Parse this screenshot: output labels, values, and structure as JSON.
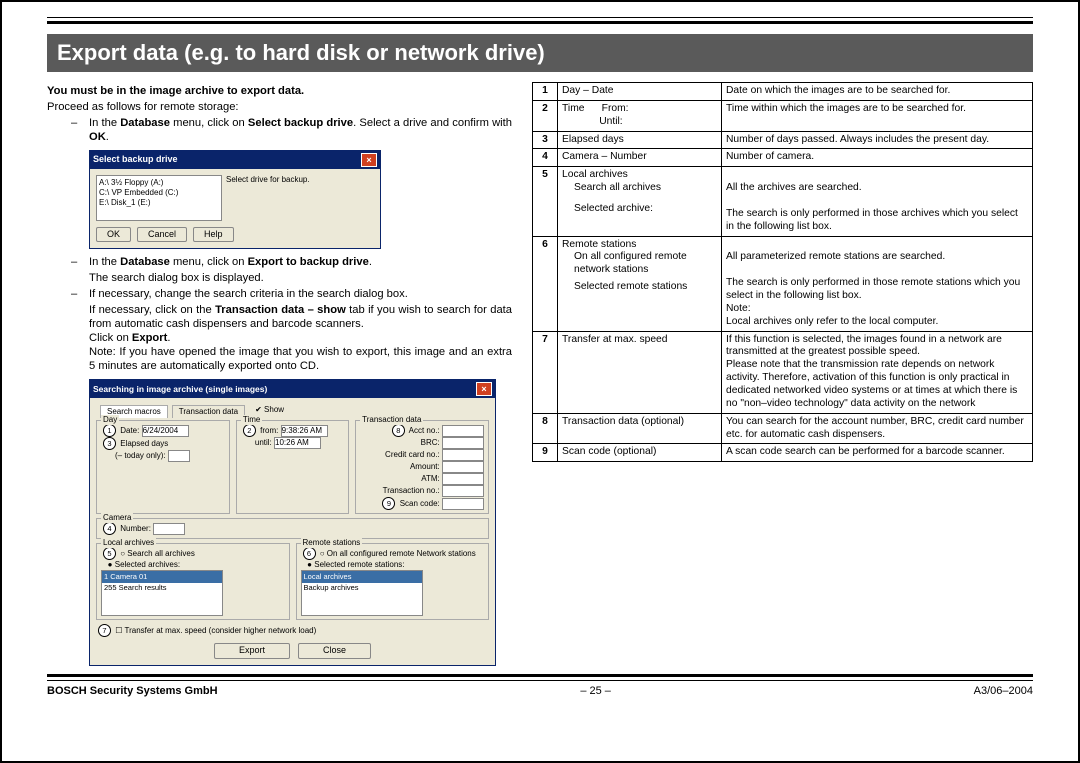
{
  "title": "Export data (e.g. to hard disk or network drive)",
  "intro_bold": "You must be in the image archive to export data.",
  "proceed": "Proceed as follows for remote storage:",
  "step1_pre": "In the ",
  "step1_b1": "Database",
  "step1_mid": " menu, click on ",
  "step1_b2": "Select backup drive",
  "step1_post": ". Select a drive and confirm with ",
  "step1_b3": "OK",
  "step1_end": ".",
  "dlg1": {
    "title": "Select backup drive",
    "items": [
      "A:\\ 3½ Floppy (A:)",
      "C:\\ VP Embedded (C:)",
      "E:\\ Disk_1 (E:)"
    ],
    "side": "Select drive for backup.",
    "ok": "OK",
    "cancel": "Cancel",
    "help": "Help"
  },
  "step2_pre": "In the ",
  "step2_b1": "Database",
  "step2_mid": " menu, click on ",
  "step2_b2": "Export to backup drive",
  "step2_end": ".",
  "step2_line2": "The search dialog box is displayed.",
  "step3": "If necessary, change the search criteria in the search dialog box.",
  "step3b_pre": "If necessary, click on the ",
  "step3b_b": "Transaction data – show",
  "step3b_post": " tab if you wish to search for data from automatic cash dispensers and barcode scanners.",
  "step4_pre": "Click on ",
  "step4_b": "Export",
  "step4_end": ".",
  "note": "Note: If you have opened the image that you wish to export, this image and an extra 5 minutes are automatically exported onto CD.",
  "dlg2": {
    "title": "Searching in image archive (single images)",
    "tab1": "Search macros",
    "tab2": "Transaction data",
    "show": "Show",
    "grp_day": "Day",
    "grp_time": "Time",
    "grp_txn": "Transaction data",
    "date_lbl": "Date:",
    "date_val": "6/24/2004",
    "from_lbl": "from:",
    "from_val": "9:38:26 AM",
    "until_lbl": "until:",
    "until_val": "10:26 AM",
    "elapsed": "Elapsed days",
    "today": "(– today only):",
    "acct": "Acct no.:",
    "brc": "BRC:",
    "cc": "Credit card no.:",
    "amount": "Amount:",
    "atm": "ATM:",
    "txnno": "Transaction no.:",
    "scan": "Scan code:",
    "grp_cam": "Camera",
    "number": "Number:",
    "grp_local": "Local archives",
    "search_all": "Search all archives",
    "selected": "Selected archives:",
    "grp_remote": "Remote stations",
    "remote_all": "On all configured remote Network stations",
    "remote_sel": "Selected remote stations:",
    "list_local_hdr": "1 Camera 01",
    "list_local_item": "255 Search results",
    "list_remote_hdr": "Local archives",
    "list_remote_item": "Backup archives",
    "transfer": "Transfer at max. speed (consider higher network load)",
    "export_btn": "Export",
    "close_btn": "Close"
  },
  "table": [
    {
      "n": "1",
      "mid": "Day  –  Date",
      "desc": "Date on which the images are to be searched for."
    },
    {
      "n": "2",
      "mid": "Time      From:\n             Until:",
      "desc": "Time within which the images are to be searched for."
    },
    {
      "n": "3",
      "mid": "Elapsed days",
      "desc": "Number of days passed. Always includes the present day."
    },
    {
      "n": "4",
      "mid": "Camera  –  Number",
      "desc": "Number of camera."
    },
    {
      "n": "5",
      "mid": "Local archives",
      "sub": [
        {
          "m": "Search all archives",
          "d": "All the archives are searched."
        },
        {
          "m": "Selected archive:",
          "d": "The search is only performed in those archives which you select in the following list box."
        }
      ]
    },
    {
      "n": "6",
      "mid": "Remote stations",
      "sub": [
        {
          "m": "On all configured remote network stations",
          "d": "All parameterized remote stations are searched."
        },
        {
          "m": "Selected remote stations",
          "d": "The search is only performed in those remote stations which you select in the following list box.\nNote:\nLocal archives only refer to the local computer."
        }
      ]
    },
    {
      "n": "7",
      "mid": "Transfer at max. speed",
      "desc": "If this function is selected, the images found in a network are transmitted at the greatest possible speed.\nPlease note that the transmission rate depends on network activity. Therefore, activation of this function is only practical in dedicated networked video systems or at times at which there is no \"non–video technology\" data activity on the network"
    },
    {
      "n": "8",
      "mid": "Transaction data (optional)",
      "desc": "You can search for the account number, BRC, credit card number etc. for automatic cash dispensers."
    },
    {
      "n": "9",
      "mid": "Scan code (optional)",
      "desc": "A scan code search can be performed for a barcode scanner."
    }
  ],
  "footer_left": "BOSCH Security Systems GmbH",
  "footer_center": "– 25 –",
  "footer_right": "A3/06–2004"
}
